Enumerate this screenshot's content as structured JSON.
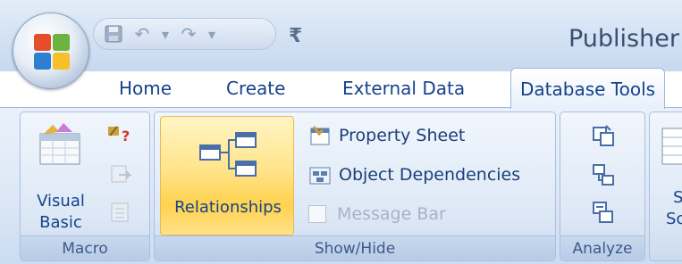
{
  "window": {
    "app_title": "Publisher :"
  },
  "quick_access": {
    "items": [
      "save-icon",
      "undo-icon",
      "redo-icon",
      "customize-icon"
    ],
    "separator_glyph": "▾",
    "undo_glyph": "↶",
    "redo_glyph": "↷",
    "dropdown_glyph": "▾",
    "customize_glyph": "₹"
  },
  "tabs": [
    {
      "label": "Home",
      "active": false
    },
    {
      "label": "Create",
      "active": false
    },
    {
      "label": "External Data",
      "active": false
    },
    {
      "label": "Database Tools",
      "active": true
    }
  ],
  "groups": {
    "macro": {
      "label": "Macro",
      "visual_basic_label_line1": "Visual",
      "visual_basic_label_line2": "Basic"
    },
    "show_hide": {
      "label": "Show/Hide",
      "relationships_label": "Relationships",
      "property_sheet_label": "Property Sheet",
      "object_dependencies_label": "Object Dependencies",
      "message_bar_label": "Message Bar"
    },
    "analyze": {
      "label": "Analyze"
    },
    "next": {
      "partial_line1": "S",
      "partial_line2": "Sc"
    }
  },
  "colors": {
    "highlight": "#ffd24f",
    "text": "#15428b",
    "ribbon_bg": "#dbe7f6"
  }
}
